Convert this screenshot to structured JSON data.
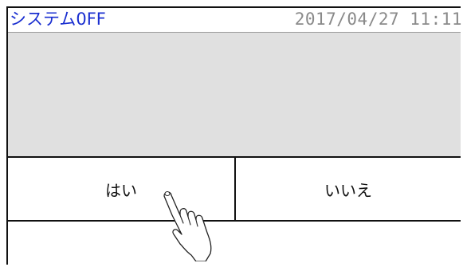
{
  "header": {
    "title": "システム0FF",
    "datetime": "2017/04/27  11:11"
  },
  "dialog": {
    "yes_label": "はい",
    "no_label": "いいえ"
  },
  "icons": {
    "pointer": "hand-pointer-icon"
  },
  "colors": {
    "title": "#1a2fd0",
    "datetime": "#8a8a8a",
    "message_bg": "#e0e0e0"
  }
}
